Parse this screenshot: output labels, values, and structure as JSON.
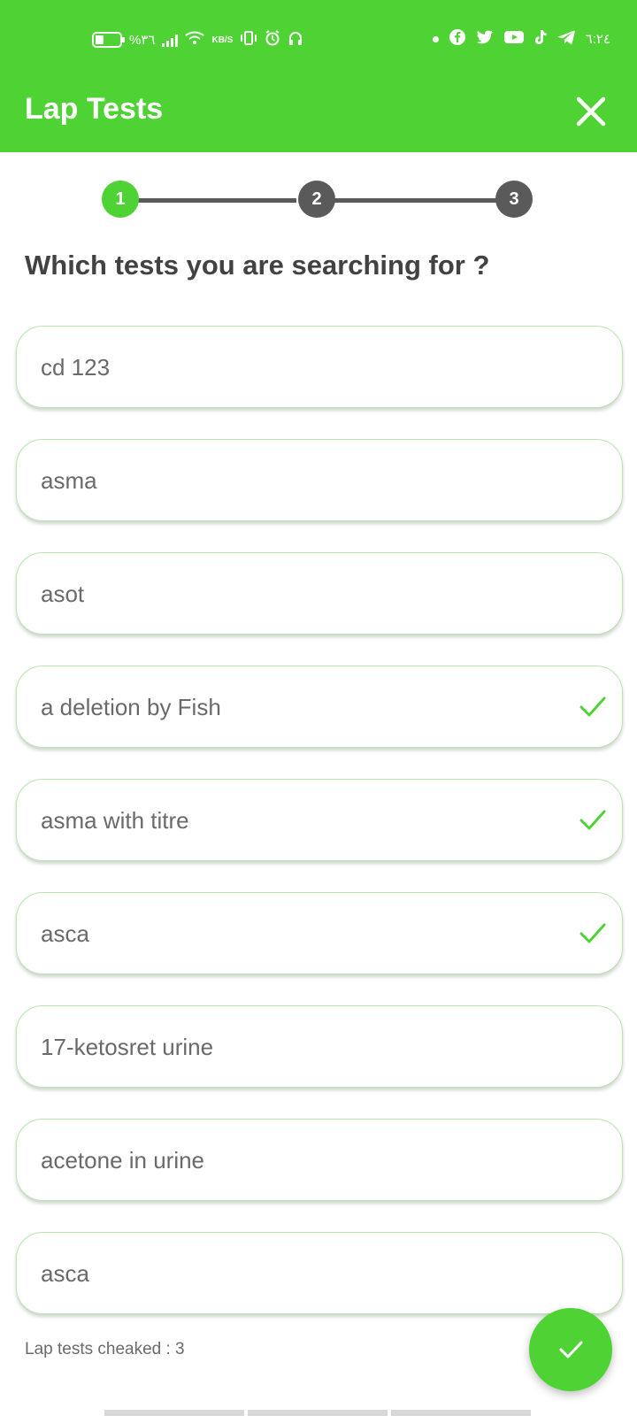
{
  "status_bar": {
    "battery_percent": "%٣٦",
    "network_speed": "KB/S",
    "time": "٦:٢٤"
  },
  "header": {
    "title": "Lap Tests"
  },
  "stepper": {
    "steps": [
      {
        "label": "1",
        "state": "active",
        "color": "#4fd234"
      },
      {
        "label": "2",
        "state": "inactive",
        "color": "#5a5a5a"
      },
      {
        "label": "3",
        "state": "inactive",
        "color": "#5a5a5a"
      }
    ]
  },
  "question": "Which tests you are searching for ?",
  "tests": [
    {
      "label": "cd 123",
      "checked": false
    },
    {
      "label": "asma",
      "checked": false
    },
    {
      "label": "asot",
      "checked": false
    },
    {
      "label": "a deletion by Fish",
      "checked": true
    },
    {
      "label": "asma with titre",
      "checked": true
    },
    {
      "label": "asca",
      "checked": true
    },
    {
      "label": "17-ketosret urine",
      "checked": false
    },
    {
      "label": "acetone in urine",
      "checked": false
    },
    {
      "label": "asca",
      "checked": false
    }
  ],
  "footer": {
    "checked_count_label": "Lap tests cheaked : 3"
  },
  "colors": {
    "accent": "#4fd234",
    "step_inactive": "#5a5a5a",
    "item_border": "#b8e6aa",
    "text": "#6a6a6a"
  }
}
